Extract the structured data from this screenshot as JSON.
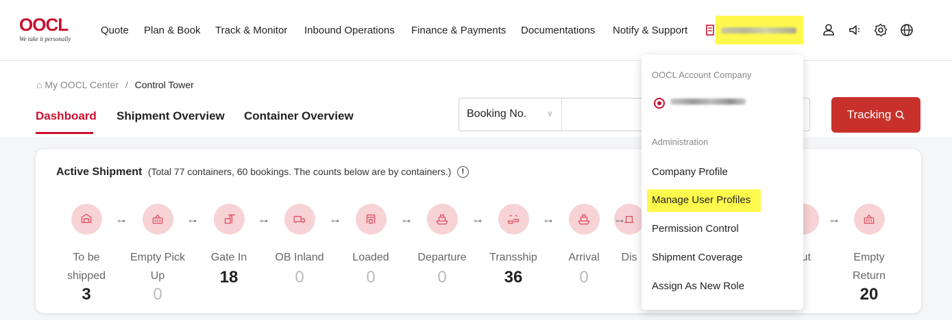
{
  "brand": {
    "name": "OOCL",
    "tagline": "We take it personally",
    "accent": "#c8102e"
  },
  "nav": {
    "items": [
      {
        "label": "Quote"
      },
      {
        "label": "Plan & Book"
      },
      {
        "label": "Track & Monitor"
      },
      {
        "label": "Inbound Operations"
      },
      {
        "label": "Finance & Payments"
      },
      {
        "label": "Documentations"
      },
      {
        "label": "Notify & Support"
      }
    ],
    "icons": [
      "user-icon",
      "announcement-icon",
      "settings-icon",
      "globe-icon"
    ]
  },
  "breadcrumb": {
    "home": "My OOCL Center",
    "separator": "/",
    "current": "Control Tower"
  },
  "tabs": [
    {
      "label": "Dashboard",
      "active": true
    },
    {
      "label": "Shipment Overview"
    },
    {
      "label": "Container Overview"
    }
  ],
  "search": {
    "type": "Booking No.",
    "value": ""
  },
  "tracking_button": "Tracking",
  "active_shipment": {
    "title": "Active Shipment",
    "subtitle": "(Total 77 containers, 60 bookings. The counts below are by containers.)",
    "stages": [
      {
        "label_line1": "To be",
        "label_line2": "shipped",
        "count": "3",
        "icon": "warehouse-icon"
      },
      {
        "label_line1": "Empty Pick",
        "label_line2": "Up",
        "count": "0",
        "icon": "empty-container-icon"
      },
      {
        "label_line1": "Gate In",
        "label_line2": "",
        "count": "18",
        "icon": "crane-icon"
      },
      {
        "label_line1": "OB Inland",
        "label_line2": "",
        "count": "0",
        "icon": "truck-icon"
      },
      {
        "label_line1": "Loaded",
        "label_line2": "",
        "count": "0",
        "icon": "port-crane-icon"
      },
      {
        "label_line1": "Departure",
        "label_line2": "",
        "count": "0",
        "icon": "ship-icon"
      },
      {
        "label_line1": "Transship",
        "label_line2": "",
        "count": "36",
        "icon": "transship-icon"
      },
      {
        "label_line1": "Arrival",
        "label_line2": "",
        "count": "0",
        "icon": "ship-arrival-icon"
      },
      {
        "label_line1": "Dis",
        "label_line2": "",
        "count": "",
        "icon": "discharge-icon"
      },
      {
        "label_line1": "Out",
        "label_line2": "",
        "count": "",
        "icon": "gate-out-icon"
      },
      {
        "label_line1": "Empty",
        "label_line2": "Return",
        "count": "20",
        "icon": "empty-return-icon"
      }
    ]
  },
  "account_menu": {
    "section_company": "OOCL Account Company",
    "section_admin": "Administration",
    "items": [
      {
        "label": "Company Profile"
      },
      {
        "label": "Manage User Profiles",
        "highlighted": true
      },
      {
        "label": "Permission Control"
      },
      {
        "label": "Shipment Coverage"
      },
      {
        "label": "Assign As New Role"
      }
    ]
  }
}
